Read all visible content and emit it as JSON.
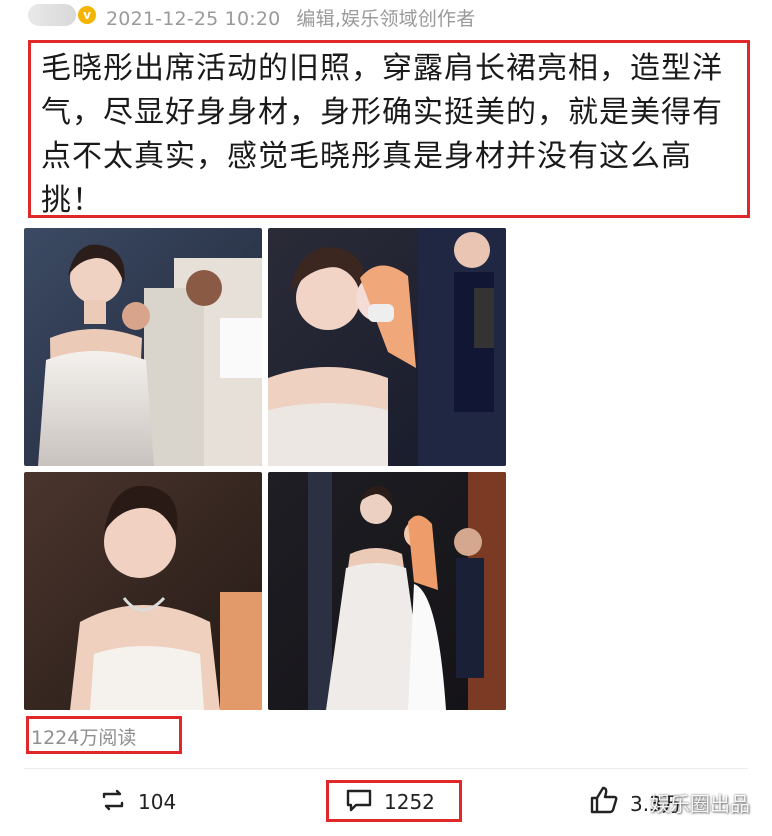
{
  "header": {
    "date_time": "2021-12-25 10:20",
    "source_note": "编辑,娱乐领域创作者",
    "verified_badge": "v"
  },
  "post": {
    "text": "毛晓彤出席活动的旧照，穿露肩长裙亮相，造型洋气，尽显好身身材，身形确实挺美的，就是美得有点不太真实，感觉毛晓彤真是身材并没有这么高挑！"
  },
  "photos": [
    {
      "name": "photo-1"
    },
    {
      "name": "photo-2"
    },
    {
      "name": "photo-3"
    },
    {
      "name": "photo-4"
    }
  ],
  "stats": {
    "reads": "1224万阅读"
  },
  "actions": {
    "repost": {
      "icon": "repost-icon",
      "count": "104"
    },
    "comment": {
      "icon": "comment-icon",
      "count": "1252"
    },
    "like": {
      "icon": "thumbs-up-icon",
      "count": "3.3万"
    }
  },
  "watermark": "娱乐圈出品",
  "colors": {
    "highlight_border": "#e0272a",
    "meta_text": "#9a9a9a",
    "verified_badge": "#f5b400"
  }
}
